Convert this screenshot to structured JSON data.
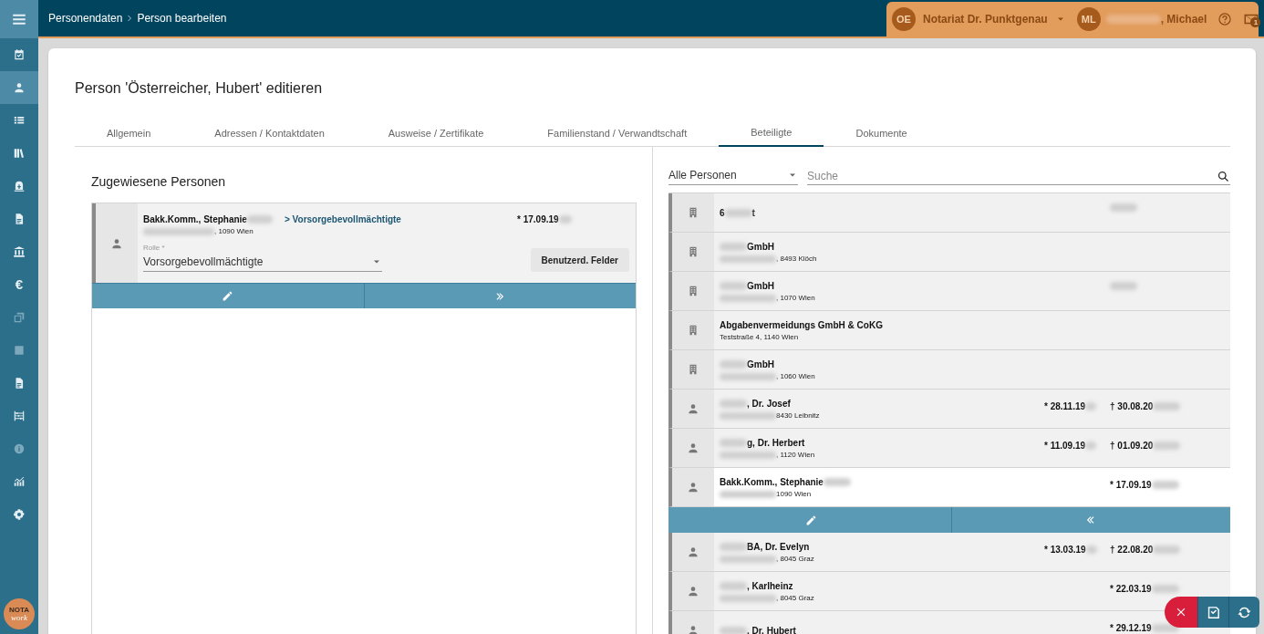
{
  "topbar": {
    "breadcrumb": [
      "Personendaten",
      "Person bearbeiten"
    ],
    "office": {
      "initials": "OE",
      "name": "Notariat Dr. Punktgenau"
    },
    "user": {
      "initials": "ML",
      "name": ", Michael"
    },
    "mail_badge": "1"
  },
  "sidebar": {
    "items": [
      {
        "kind": "calendar",
        "selected": false,
        "disabled": false
      },
      {
        "kind": "person",
        "selected": true,
        "disabled": false
      },
      {
        "kind": "list",
        "selected": false,
        "disabled": false
      },
      {
        "kind": "books",
        "selected": false,
        "disabled": false
      },
      {
        "kind": "safe",
        "selected": false,
        "disabled": false
      },
      {
        "kind": "document",
        "selected": false,
        "disabled": false
      },
      {
        "kind": "bank",
        "selected": false,
        "disabled": false
      },
      {
        "kind": "glyph",
        "glyph": "€",
        "selected": false,
        "disabled": false
      },
      {
        "kind": "copy",
        "selected": false,
        "disabled": true
      },
      {
        "kind": "square",
        "selected": false,
        "disabled": true
      },
      {
        "kind": "document",
        "selected": false,
        "disabled": false
      },
      {
        "kind": "abacus",
        "selected": false,
        "disabled": false
      },
      {
        "kind": "info",
        "selected": false,
        "disabled": true
      },
      {
        "kind": "chart",
        "selected": false,
        "disabled": false
      },
      {
        "kind": "gear",
        "selected": false,
        "disabled": false
      }
    ],
    "logo": [
      "NOTA",
      "work"
    ]
  },
  "page": {
    "title": "Person 'Österreicher, Hubert' editieren",
    "tabs": [
      {
        "label": "Allgemein",
        "selected": false
      },
      {
        "label": "Adressen / Kontaktdaten",
        "selected": false
      },
      {
        "label": "Ausweise / Zertifikate",
        "selected": false
      },
      {
        "label": "Familienstand / Verwandtschaft",
        "selected": false
      },
      {
        "label": "Beteiligte",
        "selected": true
      },
      {
        "label": "Dokumente",
        "selected": false
      }
    ]
  },
  "assigned": {
    "heading": "Zugewiesene Personen",
    "people": [
      {
        "kind": "person",
        "name": [
          {
            "kind": "text",
            "text": "Bakk.Komm., Stephanie"
          },
          {
            "kind": "blur"
          }
        ],
        "role_link": "> Vorsorgebevollmächtigte",
        "address": [
          {
            "kind": "blur"
          },
          {
            "kind": "text",
            "text": ", 1090 Wien"
          }
        ],
        "date": [
          {
            "kind": "text",
            "text": "* 17.09.19"
          },
          {
            "kind": "blur"
          }
        ],
        "role_label": "Rolle *",
        "role_value": "Vorsorgebevollmächtigte",
        "custom_fields_button": "Benutzerd. Felder"
      }
    ]
  },
  "candidates": {
    "filter": "Alle Personen",
    "search_placeholder": "Suche",
    "rows": [
      {
        "kind": "company",
        "selected": false,
        "name": [
          {
            "kind": "text",
            "text": "6"
          },
          {
            "kind": "blur"
          },
          {
            "kind": "text",
            "text": "t"
          }
        ],
        "address": [],
        "date_1": [],
        "date_2": [
          {
            "kind": "blur"
          }
        ]
      },
      {
        "kind": "company",
        "selected": false,
        "name": [
          {
            "kind": "blur"
          },
          {
            "kind": "text",
            "text": "GmbH"
          }
        ],
        "address": [
          {
            "kind": "blur"
          },
          {
            "kind": "text",
            "text": ", 8493 Klöch"
          }
        ],
        "date_1": [],
        "date_2": []
      },
      {
        "kind": "company",
        "selected": false,
        "name": [
          {
            "kind": "blur"
          },
          {
            "kind": "text",
            "text": "GmbH"
          }
        ],
        "address": [
          {
            "kind": "blur"
          },
          {
            "kind": "text",
            "text": ", 1070 Wien"
          }
        ],
        "date_1": [],
        "date_2": [
          {
            "kind": "blur"
          }
        ]
      },
      {
        "kind": "company",
        "selected": false,
        "name": [
          {
            "kind": "text",
            "text": "Abgabenvermeidungs GmbH & CoKG"
          }
        ],
        "address": [
          {
            "kind": "text",
            "text": "Teststraße 4, 1140 Wien"
          }
        ],
        "date_1": [],
        "date_2": []
      },
      {
        "kind": "company",
        "selected": false,
        "name": [
          {
            "kind": "blur"
          },
          {
            "kind": "text",
            "text": "GmbH"
          }
        ],
        "address": [
          {
            "kind": "blur"
          },
          {
            "kind": "text",
            "text": ", 1060 Wien"
          }
        ],
        "date_1": [],
        "date_2": []
      },
      {
        "kind": "person",
        "selected": false,
        "name": [
          {
            "kind": "blur"
          },
          {
            "kind": "text",
            "text": ", Dr. Josef"
          }
        ],
        "address": [
          {
            "kind": "blur"
          },
          {
            "kind": "text",
            "text": "8430 Leibnitz"
          }
        ],
        "date_1": [
          {
            "kind": "text",
            "text": "* 28.11.19"
          },
          {
            "kind": "blur"
          }
        ],
        "date_2": [
          {
            "kind": "text",
            "text": "† 30.08.20"
          },
          {
            "kind": "blur"
          }
        ]
      },
      {
        "kind": "person",
        "selected": false,
        "name": [
          {
            "kind": "blur"
          },
          {
            "kind": "text",
            "text": "g, Dr. Herbert"
          }
        ],
        "address": [
          {
            "kind": "blur"
          },
          {
            "kind": "text",
            "text": ", 1120 Wien"
          }
        ],
        "date_1": [
          {
            "kind": "text",
            "text": "* 11.09.19"
          },
          {
            "kind": "blur"
          }
        ],
        "date_2": [
          {
            "kind": "text",
            "text": "† 01.09.20"
          },
          {
            "kind": "blur"
          }
        ]
      },
      {
        "kind": "person",
        "selected": true,
        "name": [
          {
            "kind": "text",
            "text": "Bakk.Komm., Stephanie"
          },
          {
            "kind": "blur"
          }
        ],
        "address": [
          {
            "kind": "blur"
          },
          {
            "kind": "text",
            "text": "1090 Wien"
          }
        ],
        "date_1": [],
        "date_2": [
          {
            "kind": "text",
            "text": "* 17.09.19"
          },
          {
            "kind": "blur"
          }
        ]
      },
      {
        "kind": "person",
        "selected": false,
        "name": [
          {
            "kind": "blur"
          },
          {
            "kind": "text",
            "text": "BA, Dr. Evelyn"
          }
        ],
        "address": [
          {
            "kind": "blur"
          },
          {
            "kind": "text",
            "text": ", 8045 Graz"
          }
        ],
        "date_1": [
          {
            "kind": "text",
            "text": "* 13.03.19"
          },
          {
            "kind": "blur"
          }
        ],
        "date_2": [
          {
            "kind": "text",
            "text": "† 22.08.20"
          },
          {
            "kind": "blur"
          }
        ]
      },
      {
        "kind": "person",
        "selected": false,
        "name": [
          {
            "kind": "blur"
          },
          {
            "kind": "text",
            "text": ", Karlheinz"
          }
        ],
        "address": [
          {
            "kind": "blur"
          },
          {
            "kind": "text",
            "text": ", 8045 Graz"
          }
        ],
        "date_1": [],
        "date_2": [
          {
            "kind": "text",
            "text": "* 22.03.19"
          },
          {
            "kind": "blur"
          }
        ]
      },
      {
        "kind": "person",
        "selected": false,
        "name": [
          {
            "kind": "blur"
          },
          {
            "kind": "text",
            "text": ", Dr. Hubert"
          }
        ],
        "address": [],
        "date_1": [],
        "date_2": [
          {
            "kind": "text",
            "text": "* 29.12.19"
          },
          {
            "kind": "blur"
          }
        ]
      }
    ]
  }
}
